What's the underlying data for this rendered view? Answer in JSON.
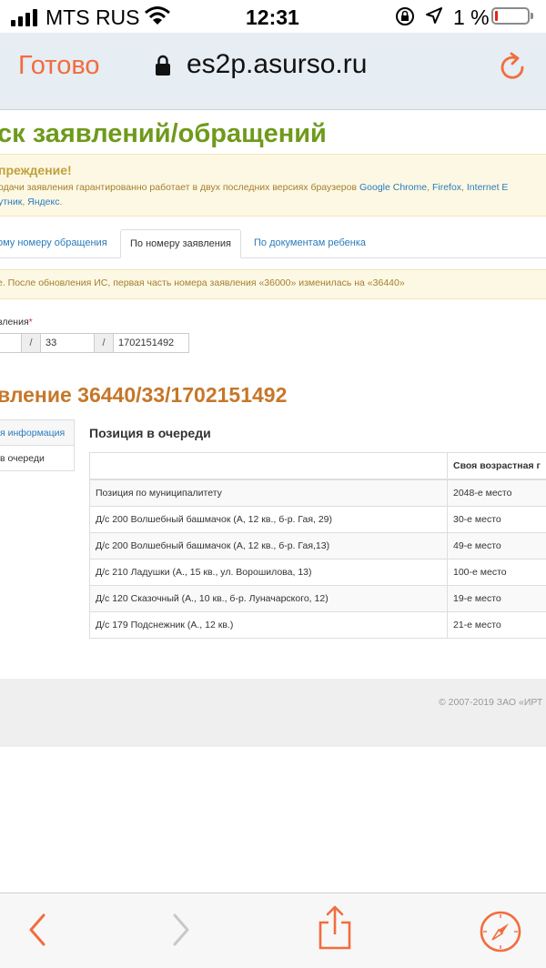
{
  "status_bar": {
    "carrier": "MTS RUS",
    "time": "12:31",
    "battery_percent": "1 %",
    "battery_level": 0.01
  },
  "browser": {
    "done_label": "Готово",
    "url": "es2p.asurso.ru"
  },
  "page": {
    "title": "ск заявлений/обращений",
    "warning": {
      "title": "преждение!",
      "line1_text": "одачи заявления гарантированно работает в двух последних версиях браузеров ",
      "line1_links": [
        "Google Chrome",
        "Firefox",
        "Internet E"
      ],
      "line2_link1": "утник",
      "line2_link2": "Яндекс"
    },
    "tabs": [
      {
        "label": "ому номеру обращения",
        "active": false
      },
      {
        "label": "По номеру заявления",
        "active": true
      },
      {
        "label": "По документам ребенка",
        "active": false
      }
    ],
    "notice": "е. После обновления ИС, первая часть номера заявления «36000» изменилась на «36440»",
    "field": {
      "label": "вления",
      "required_mark": "*",
      "sep1": "/",
      "part2": "33",
      "sep2": "/",
      "part3": "1702151492"
    },
    "application_title": "вление 36440/33/1702151492",
    "side_menu": [
      {
        "label": "я информация",
        "active": true
      },
      {
        "label": "в очереди",
        "active": false
      }
    ],
    "queue": {
      "title": "Позиция в очереди",
      "col_header": "Своя возрастная г",
      "rows": [
        {
          "name": "Позиция по муниципалитету",
          "place": "2048-е место"
        },
        {
          "name": "Д/с 200 Волшебный башмачок (А, 12 кв., б-р. Гая, 29)",
          "place": "30-е место"
        },
        {
          "name": "Д/с 200 Волшебный башмачок (А, 12 кв., б-р. Гая,13)",
          "place": "49-е место"
        },
        {
          "name": "Д/с 210 Ладушки (А., 15 кв., ул. Ворошилова, 13)",
          "place": "100-е место"
        },
        {
          "name": "Д/с 120 Сказочный (А., 10 кв., б-р. Луначарского, 12)",
          "place": "19-е место"
        },
        {
          "name": "Д/с 179 Подснежник (А., 12 кв.)",
          "place": "21-е место"
        }
      ]
    },
    "footer": "© 2007-2019 ЗАО «ИРТ"
  },
  "colors": {
    "title_green": "#6f9a1b",
    "app_title_orange": "#c6772a",
    "link_blue": "#2a7bbd",
    "ios_orange": "#f26d3d"
  }
}
